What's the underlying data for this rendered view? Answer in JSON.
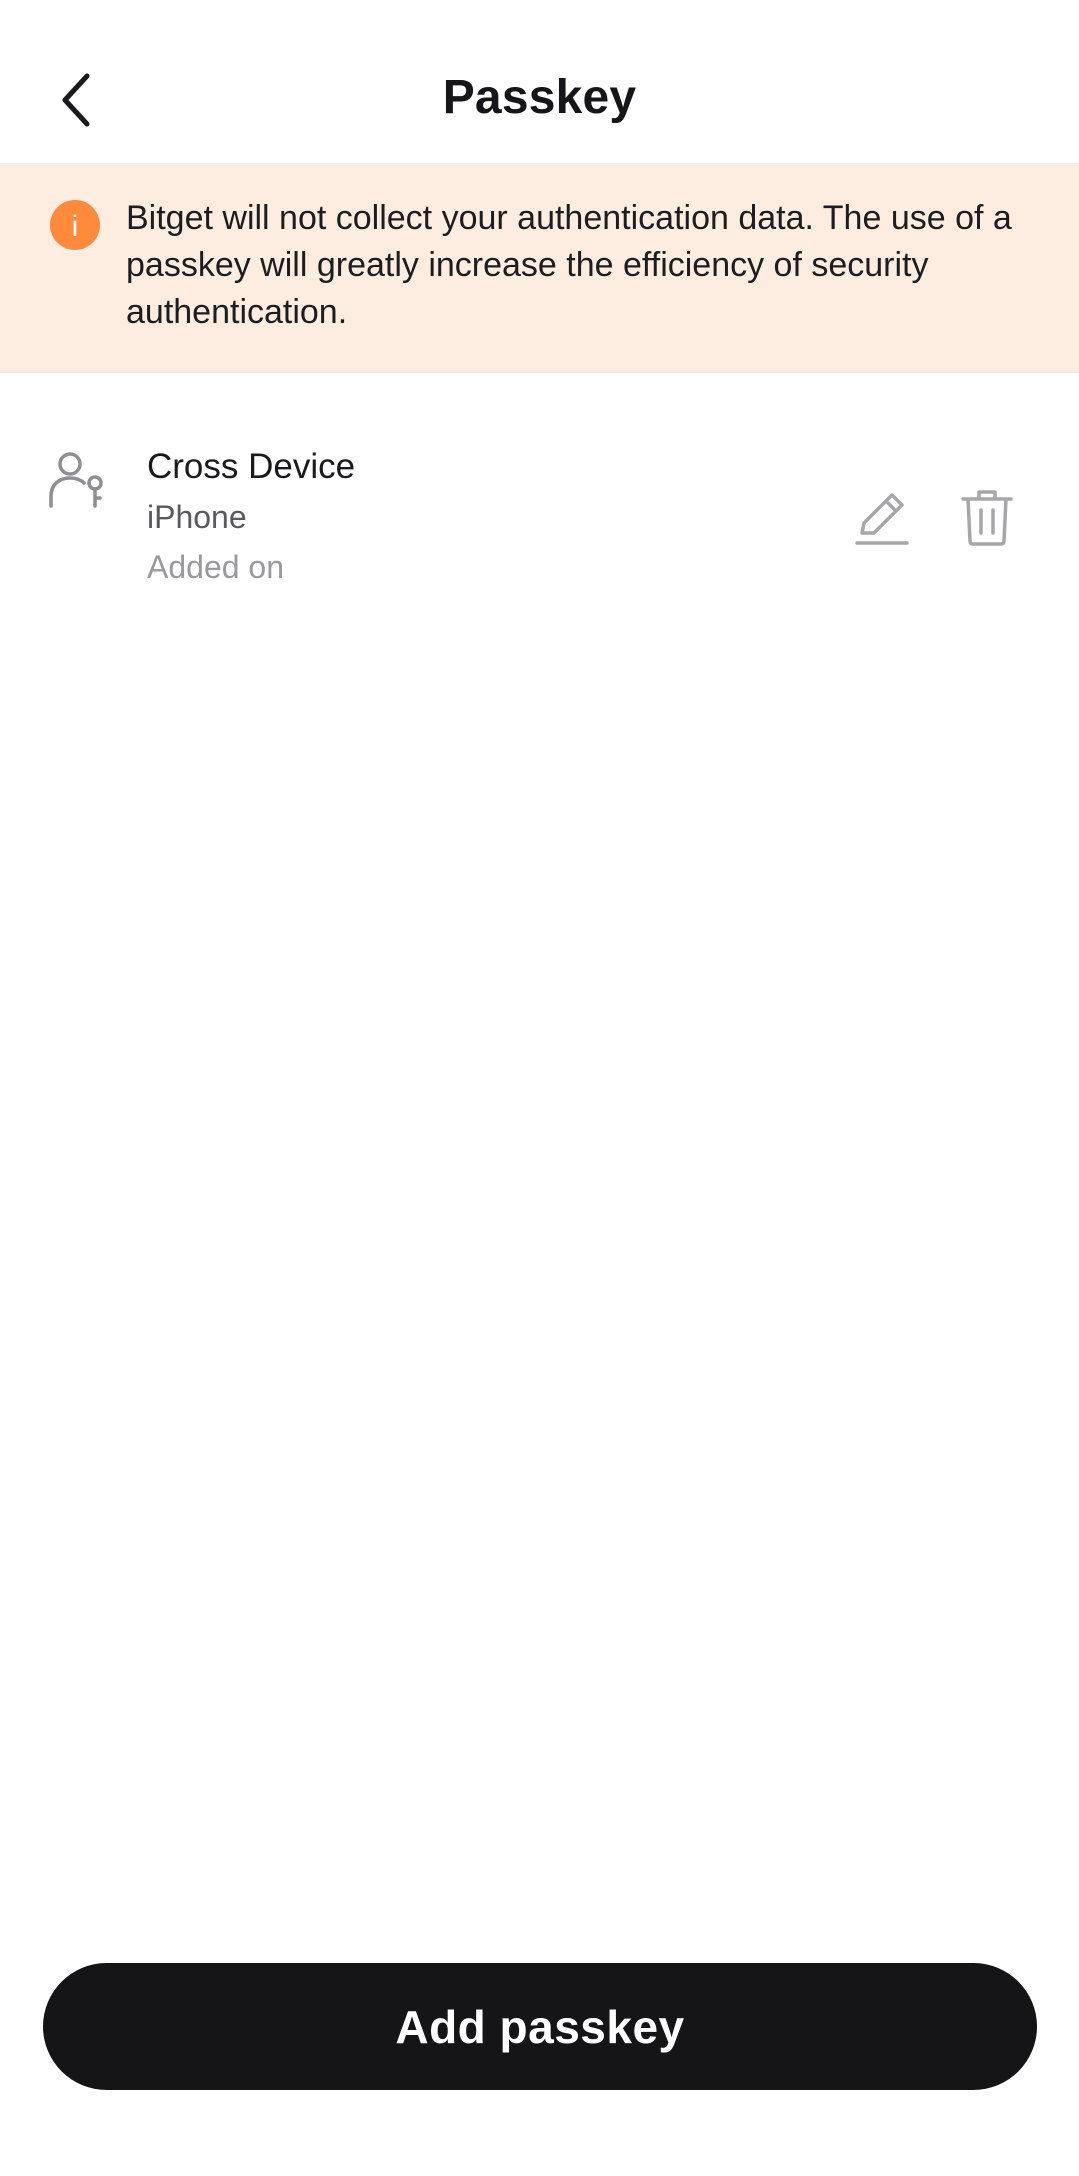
{
  "header": {
    "title": "Passkey",
    "back_icon": "chevron-left-icon"
  },
  "notice": {
    "icon": "info-icon",
    "icon_color": "#ff8a3c",
    "background": "#fcede0",
    "icon_glyph": "i",
    "text": "Bitget will not collect your authentication data. The use of a passkey will greatly increase the efficiency of security authentication."
  },
  "passkeys": [
    {
      "icon": "user-key-icon",
      "name": "Cross Device",
      "device": "iPhone",
      "added_label": "Added on",
      "edit_icon": "pencil-icon",
      "delete_icon": "trash-icon"
    }
  ],
  "footer": {
    "add_label": "Add passkey",
    "button_color": "#151518"
  }
}
